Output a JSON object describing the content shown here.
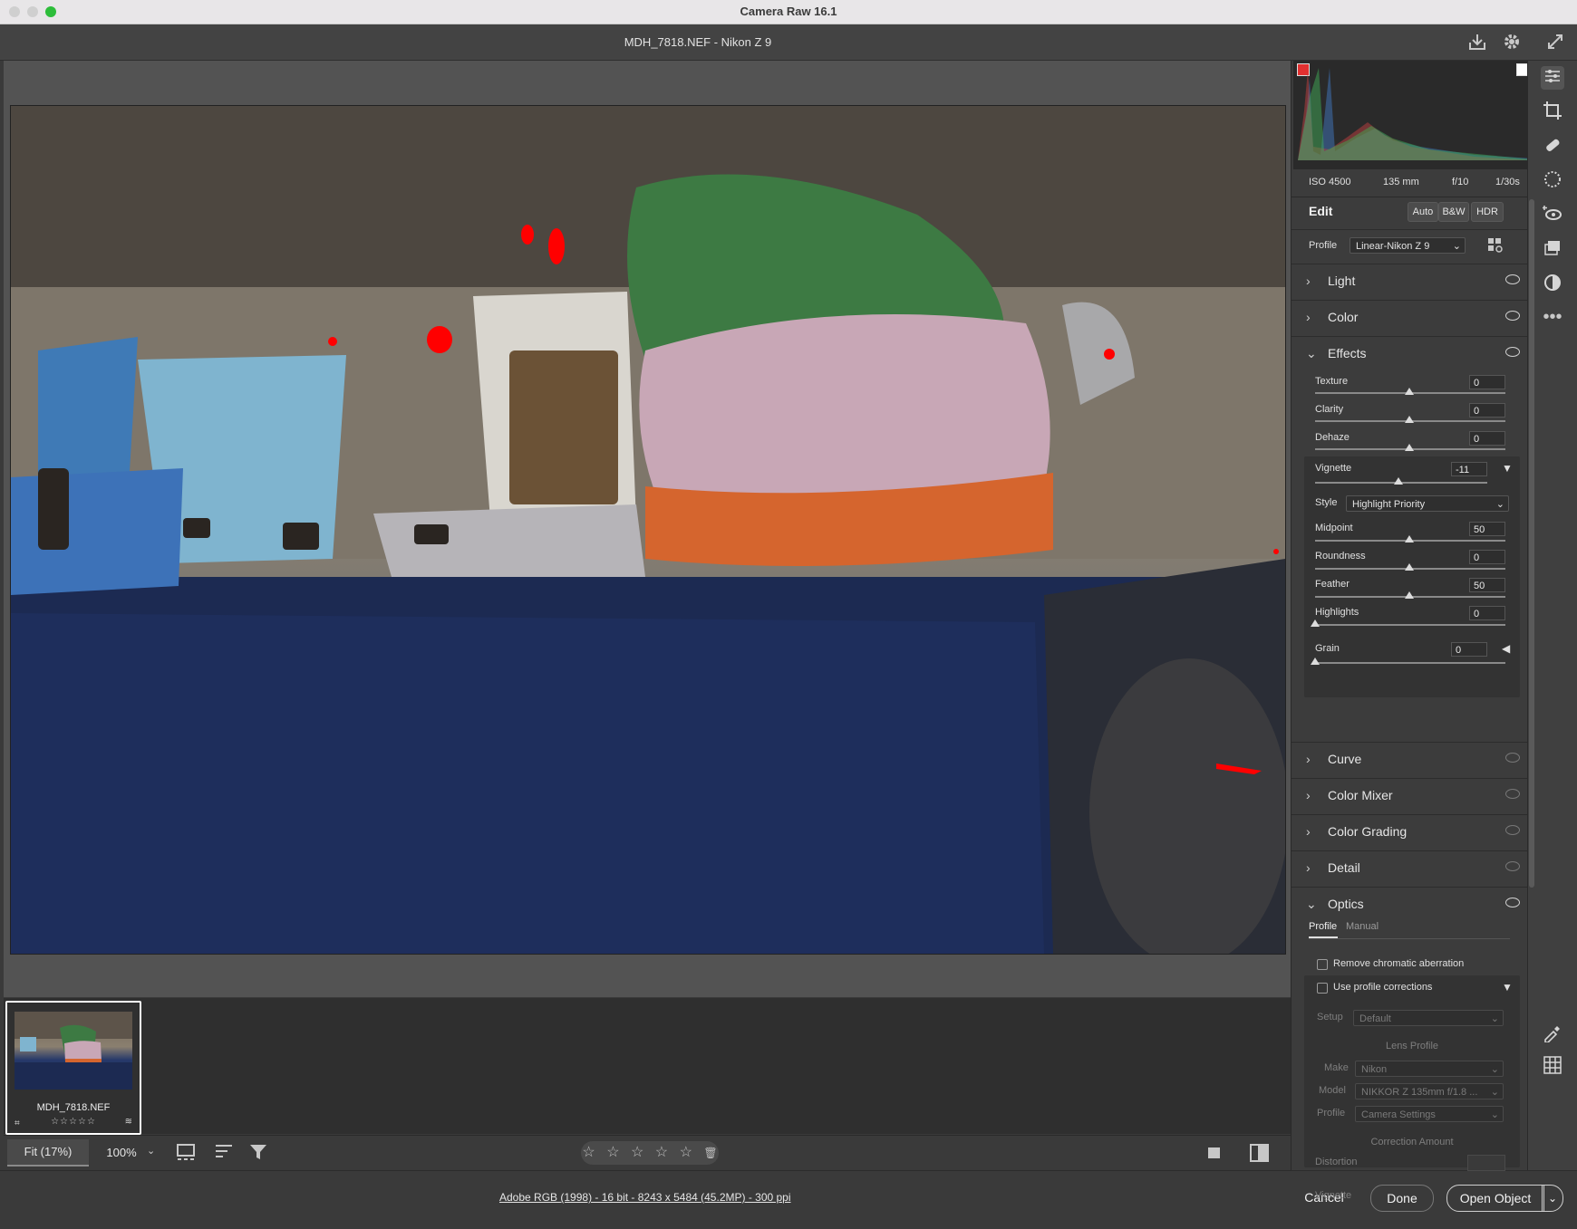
{
  "window": {
    "title": "Camera Raw 16.1"
  },
  "header": {
    "file_title": "MDH_7818.NEF  -  Nikon Z 9",
    "icons": [
      "save-icon",
      "settings-gear-icon",
      "fullscreen-icon"
    ]
  },
  "colors": {
    "accent": "#ffffff",
    "background": "#3a3a3a",
    "panel": "#3c3c3c",
    "clipping_red": "#ff0000"
  },
  "exif": {
    "iso": "ISO 4500",
    "focal": "135 mm",
    "aperture": "f/10",
    "shutter": "1/30s"
  },
  "edit": {
    "label": "Edit",
    "auto": "Auto",
    "bw": "B&W",
    "hdr": "HDR"
  },
  "profile": {
    "label": "Profile",
    "value": "Linear-Nikon Z 9"
  },
  "sections": {
    "light": "Light",
    "color": "Color",
    "effects": "Effects",
    "curve": "Curve",
    "color_mixer": "Color Mixer",
    "color_grading": "Color Grading",
    "detail": "Detail",
    "optics": "Optics"
  },
  "effects": {
    "texture": {
      "label": "Texture",
      "value": "0"
    },
    "clarity": {
      "label": "Clarity",
      "value": "0"
    },
    "dehaze": {
      "label": "Dehaze",
      "value": "0"
    },
    "vignette": {
      "label": "Vignette",
      "value": "-11"
    },
    "style": {
      "label": "Style",
      "value": "Highlight Priority"
    },
    "midpoint": {
      "label": "Midpoint",
      "value": "50"
    },
    "roundness": {
      "label": "Roundness",
      "value": "0"
    },
    "feather": {
      "label": "Feather",
      "value": "50"
    },
    "highlights": {
      "label": "Highlights",
      "value": "0"
    },
    "grain": {
      "label": "Grain",
      "value": "0"
    }
  },
  "optics": {
    "tab_profile": "Profile",
    "tab_manual": "Manual",
    "remove_ca": "Remove chromatic aberration",
    "use_profile": "Use profile corrections",
    "setup_label": "Setup",
    "setup_value": "Default",
    "lens_profile_title": "Lens Profile",
    "make_label": "Make",
    "make_value": "Nikon",
    "model_label": "Model",
    "model_value": "NIKKOR Z 135mm f/1.8 ...",
    "profile_label": "Profile",
    "profile_value": "Camera Settings",
    "correction_title": "Correction Amount",
    "distortion_label": "Distortion",
    "vignette_label": "Vignette"
  },
  "filmstrip": {
    "filename": "MDH_7818.NEF",
    "stars": "☆☆☆☆☆"
  },
  "toolbar": {
    "fit": "Fit (17%)",
    "zoom": "100%",
    "rating_stars": "☆ ☆ ☆ ☆ ☆"
  },
  "footer": {
    "info": "Adobe RGB (1998) - 16 bit - 8243 x 5484 (45.2MP) - 300 ppi",
    "cancel": "Cancel",
    "done": "Done",
    "open": "Open Object"
  }
}
